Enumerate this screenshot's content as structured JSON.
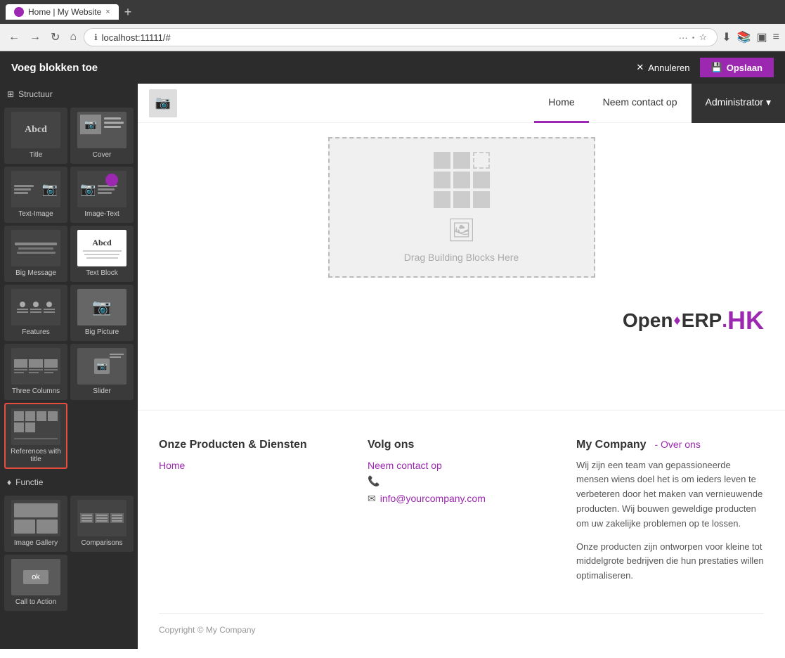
{
  "browser": {
    "tab_title": "Home | My Website",
    "favicon": "●",
    "close_label": "×",
    "new_tab_label": "+",
    "address": "localhost:11111/#",
    "nav_back": "←",
    "nav_forward": "→",
    "nav_reload": "↻",
    "nav_home": "⌂",
    "secure_icon": "ℹ"
  },
  "editor": {
    "title": "Voeg blokken toe",
    "annuleren_label": "Annuleren",
    "opslaan_label": "Opslaan",
    "cancel_icon": "✕",
    "save_icon": "💾",
    "section_structuur": "Structuur",
    "section_functie": "Functie",
    "blocks": [
      {
        "id": "title",
        "label": "Title"
      },
      {
        "id": "cover",
        "label": "Cover"
      },
      {
        "id": "text-image",
        "label": "Text-Image"
      },
      {
        "id": "image-text",
        "label": "Image-Text"
      },
      {
        "id": "big-message",
        "label": "Big Message"
      },
      {
        "id": "text-block",
        "label": "Text Block"
      },
      {
        "id": "features",
        "label": "Features"
      },
      {
        "id": "big-picture",
        "label": "Big Picture"
      },
      {
        "id": "three-columns",
        "label": "Three Columns"
      },
      {
        "id": "slider",
        "label": "Slider"
      },
      {
        "id": "references-with-title",
        "label": "References with title",
        "selected": true
      },
      {
        "id": "image-gallery",
        "label": "Image Gallery"
      },
      {
        "id": "comparisons",
        "label": "Comparisons"
      },
      {
        "id": "ok-button",
        "label": "Call to Action"
      }
    ]
  },
  "website": {
    "nav_logo_alt": "logo",
    "nav_links": [
      {
        "label": "Home",
        "active": true
      },
      {
        "label": "Neem contact op",
        "active": false
      }
    ],
    "nav_admin": "Administrator",
    "nav_admin_arrow": "▾",
    "drop_zone_text": "Drag Building Blocks Here",
    "openerp_logo": "OpenERP.HK"
  },
  "footer": {
    "col1_title": "Onze Producten & Diensten",
    "col1_link": "Home",
    "col2_title": "Volg ons",
    "col2_link": "Neem contact op",
    "col2_phone": "📞",
    "col2_email_icon": "✉",
    "col2_email": "info@yourcompany.com",
    "col3_heading": "My Company",
    "col3_over_ons": "- Over ons",
    "col3_text1": "Wij zijn een team van gepassioneerde mensen wiens doel het is om ieders leven te verbeteren door het maken van vernieuwende producten. Wij bouwen geweldige producten om uw zakelijke problemen op te lossen.",
    "col3_text2": "Onze producten zijn ontworpen voor kleine tot middelgrote bedrijven die hun prestaties willen optimaliseren.",
    "copyright": "Copyright © My Company"
  }
}
